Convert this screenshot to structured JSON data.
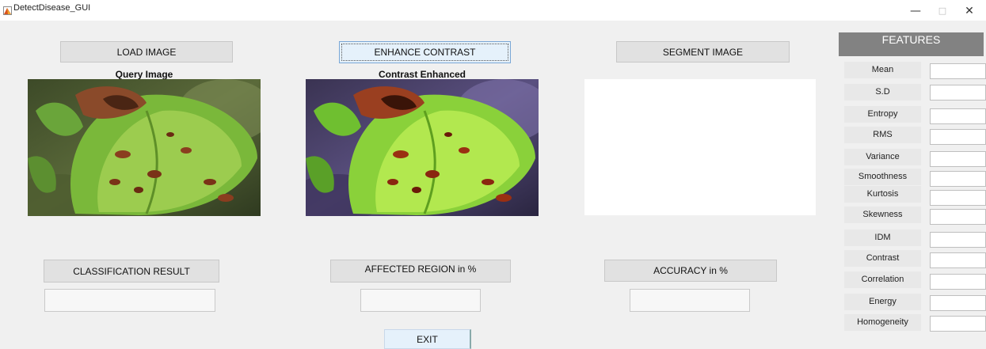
{
  "window": {
    "title": "DetectDisease_GUI",
    "minimize_glyph": "—",
    "maximize_glyph": "□",
    "close_glyph": "✕"
  },
  "buttons": {
    "load_image": "LOAD IMAGE",
    "enhance_contrast": "ENHANCE CONTRAST",
    "segment_image": "SEGMENT IMAGE",
    "classification_result": "CLASSIFICATION RESULT",
    "affected_region": "AFFECTED REGION in %",
    "accuracy": "ACCURACY in %",
    "exit": "EXIT"
  },
  "images": {
    "query_caption": "Query Image",
    "enhanced_caption": "Contrast Enhanced"
  },
  "results": {
    "classification_value": "",
    "affected_region_value": "",
    "accuracy_value": ""
  },
  "features": {
    "title": "FEATURES",
    "items": [
      {
        "label": "Mean",
        "value": ""
      },
      {
        "label": "S.D",
        "value": ""
      },
      {
        "label": "Entropy",
        "value": ""
      },
      {
        "label": "RMS",
        "value": ""
      },
      {
        "label": "Variance",
        "value": ""
      },
      {
        "label": "Smoothness",
        "value": ""
      },
      {
        "label": "Kurtosis",
        "value": ""
      },
      {
        "label": "Skewness",
        "value": ""
      },
      {
        "label": "IDM",
        "value": ""
      },
      {
        "label": "Contrast",
        "value": ""
      },
      {
        "label": "Correlation",
        "value": ""
      },
      {
        "label": "Energy",
        "value": ""
      },
      {
        "label": "Homogeneity",
        "value": ""
      }
    ]
  },
  "icons": {
    "app": "matlab-figure-icon",
    "leaf": "leaf-photo"
  }
}
